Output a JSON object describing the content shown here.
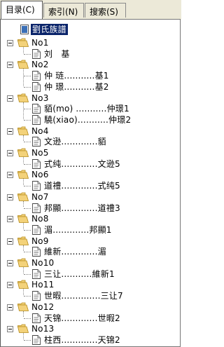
{
  "tabs": [
    {
      "label": "目录(C)",
      "active": true
    },
    {
      "label": "索引(N)",
      "active": false
    },
    {
      "label": "搜索(S)",
      "active": false
    }
  ],
  "root": {
    "label": "劉氏族譜"
  },
  "groups": [
    {
      "name": "No1",
      "items": [
        "刘　基"
      ]
    },
    {
      "name": "No2",
      "items": [
        "仲 琏...........基1",
        "仲 璟...........基2"
      ]
    },
    {
      "name": "No3",
      "items": [
        "貊(mo) ...........仲璟1",
        "驍(xiao)...........仲璟2"
      ]
    },
    {
      "name": "No4",
      "items": [
        "文逊.............貊"
      ]
    },
    {
      "name": "No5",
      "items": [
        "式纯.............文逊5"
      ]
    },
    {
      "name": "No6",
      "items": [
        "道禮.............式纯5"
      ]
    },
    {
      "name": "No7",
      "items": [
        "邦顯.............道禮3"
      ]
    },
    {
      "name": "No8",
      "items": [
        "湄.............邦顯1"
      ]
    },
    {
      "name": "No9",
      "items": [
        "維新.............湄"
      ]
    },
    {
      "name": "No10",
      "items": [
        "三让...........維新1"
      ]
    },
    {
      "name": "Ho11",
      "items": [
        "世暇..............三让7"
      ]
    },
    {
      "name": "No12",
      "items": [
        "天锦.............世暇2"
      ]
    },
    {
      "name": "No13",
      "items": [
        "柱西.............天锦2"
      ]
    }
  ],
  "colors": {
    "selection": "#0a246a",
    "folder": "#f3d27a",
    "folder_edge": "#b58a1a"
  }
}
